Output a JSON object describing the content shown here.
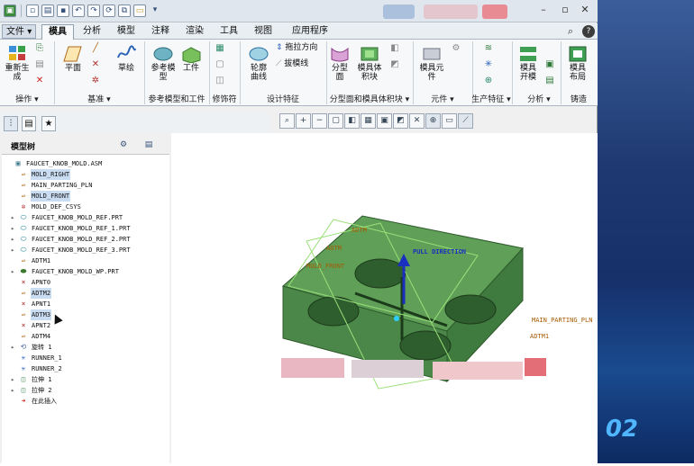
{
  "titlebar": {
    "quick_access": [
      "new-icon",
      "open-icon",
      "save-icon",
      "undo-icon",
      "redo-icon",
      "regenerate-icon",
      "windows-icon",
      "folder-icon"
    ]
  },
  "menu": {
    "file_label": "文件",
    "file_arrow": "▾",
    "tabs": [
      "模具",
      "分析",
      "模型",
      "注释",
      "渲染",
      "工具",
      "视图",
      "应用程序"
    ],
    "active_tab": "模具"
  },
  "ribbon": {
    "groups": [
      {
        "label": "操作 ▾"
      },
      {
        "label": "基准 ▾"
      },
      {
        "label": "参考模型和工件"
      },
      {
        "label": "修饰符"
      },
      {
        "label": "设计特征"
      },
      {
        "label": "分型面和模具体积块 ▾"
      },
      {
        "label": "元件 ▾"
      },
      {
        "label": "生产特征 ▾"
      },
      {
        "label": "分析 ▾"
      },
      {
        "label": "铸造"
      }
    ],
    "buttons": {
      "regenerate": "重新生成",
      "plane": "平面",
      "sketch": "草绘",
      "ref_model": "参考模型",
      "workpiece": "工件",
      "outline_curve_1": "轮廓",
      "outline_curve_2": "曲线",
      "drag_direction": "拖拉方向",
      "draft_line": "拔模线",
      "parting_surface_1": "分型",
      "parting_surface_2": "面",
      "mold_volume_1": "模具体",
      "mold_volume_2": "积块",
      "mold_component_1": "模具元",
      "mold_component_2": "件",
      "mold_open_1": "模具",
      "mold_open_2": "开模",
      "mold_layout_1": "模具",
      "mold_layout_2": "布局"
    }
  },
  "model_tree": {
    "title": "模型树",
    "nodes": [
      {
        "label": "FAUCET_KNOB_MOLD.ASM",
        "icon": "assembly-icon",
        "hl": false
      },
      {
        "label": "MOLD_RIGHT",
        "icon": "datum-plane-icon",
        "hl": true
      },
      {
        "label": "MAIN_PARTING_PLN",
        "icon": "datum-plane-icon",
        "hl": false
      },
      {
        "label": "MOLD_FRONT",
        "icon": "datum-plane-icon",
        "hl": true
      },
      {
        "label": "MOLD_DEF_CSYS",
        "icon": "csys-icon",
        "hl": false
      },
      {
        "label": "FAUCET_KNOB_MOLD_REF.PRT",
        "icon": "part-icon",
        "hl": false
      },
      {
        "label": "FAUCET_KNOB_MOLD_REF_1.PRT",
        "icon": "part-icon",
        "hl": false
      },
      {
        "label": "FAUCET_KNOB_MOLD_REF_2.PRT",
        "icon": "part-icon",
        "hl": false
      },
      {
        "label": "FAUCET_KNOB_MOLD_REF_3.PRT",
        "icon": "part-icon",
        "hl": false
      },
      {
        "label": "ADTM1",
        "icon": "datum-plane-icon",
        "hl": false
      },
      {
        "label": "FAUCET_KNOB_MOLD_WP.PRT",
        "icon": "workpiece-icon",
        "hl": false
      },
      {
        "label": "APNT0",
        "icon": "datum-point-icon",
        "hl": false
      },
      {
        "label": "ADTM2",
        "icon": "datum-plane-icon",
        "hl": true
      },
      {
        "label": "APNT1",
        "icon": "datum-point-icon",
        "hl": false
      },
      {
        "label": "ADTM3",
        "icon": "datum-plane-icon",
        "hl": true
      },
      {
        "label": "APNT2",
        "icon": "datum-point-icon",
        "hl": false
      },
      {
        "label": "ADTM4",
        "icon": "datum-plane-icon",
        "hl": false
      },
      {
        "label": "旋转 1",
        "icon": "revolve-icon",
        "hl": false
      },
      {
        "label": "RUNNER_1",
        "icon": "runner-icon",
        "hl": false
      },
      {
        "label": "RUNNER_2",
        "icon": "runner-icon",
        "hl": false
      },
      {
        "label": "拉伸 1",
        "icon": "extrude-icon",
        "hl": false
      },
      {
        "label": "拉伸 2",
        "icon": "extrude-icon",
        "hl": false
      },
      {
        "label": "在此插入",
        "icon": "insert-here-icon",
        "hl": false
      }
    ]
  },
  "graphics": {
    "labels": {
      "pull_direction": "PULL DIRECTION",
      "main_parting_pln": "MAIN_PARTING_PLN",
      "adtm1": "ADTM1",
      "adtm_a": "ADTM",
      "adtm_b": "ADTM",
      "mold_front": "MOLD_FRONT"
    },
    "model_color": "#5a9a55"
  },
  "side_banner": {
    "number": "02"
  }
}
